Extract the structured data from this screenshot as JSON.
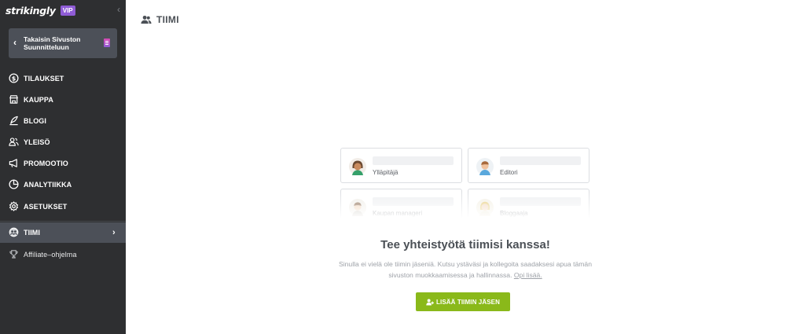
{
  "brand": {
    "logo": "strikingly",
    "badge": "VIP"
  },
  "sidebar": {
    "back_button": "Takaisin Sivuston Suunnitteluun",
    "items": [
      {
        "label": "TILAUKSET",
        "icon": "dollar-circle-icon"
      },
      {
        "label": "KAUPPA",
        "icon": "store-icon"
      },
      {
        "label": "BLOGI",
        "icon": "quill-icon"
      },
      {
        "label": "YLEISÖ",
        "icon": "audience-icon"
      },
      {
        "label": "PROMOOTIO",
        "icon": "megaphone-icon"
      },
      {
        "label": "ANALYTIIKKA",
        "icon": "pie-chart-icon"
      },
      {
        "label": "ASETUKSET",
        "icon": "gear-icon"
      },
      {
        "label": "TIIMI",
        "icon": "team-icon",
        "active": true
      },
      {
        "label": "Affiliate–ohjelma",
        "icon": "trophy-icon"
      }
    ]
  },
  "main": {
    "title": "TIIMI",
    "roles": [
      "Ylläpitäjä",
      "Editori",
      "Kaupan manageri",
      "Bloggaaja"
    ],
    "cta_title": "Tee yhteistyötä tiimisi kanssa!",
    "cta_desc": "Sinulla ei vielä ole tiimin jäseniä. Kutsu ystäväsi ja kollegoita saadaksesi apua tämän sivuston muokkaamisessa ja hallinnassa.",
    "learn_more": "Opi lisää.",
    "add_button": "LISÄÄ TIIMIN JÄSEN"
  },
  "colors": {
    "sidebar_bg": "#2e2f31",
    "active_bg": "#4c5058",
    "vip": "#8f5cd6",
    "cta_green": "#8ab91a"
  }
}
